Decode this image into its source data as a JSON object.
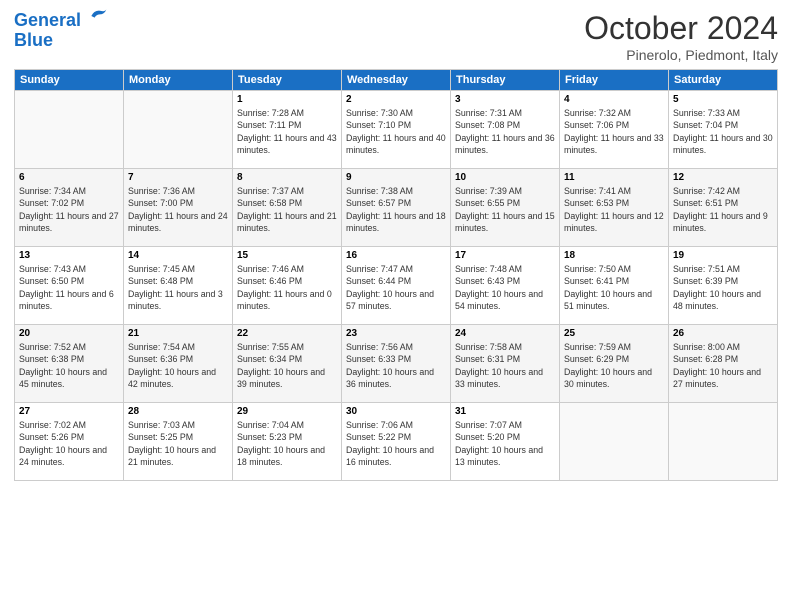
{
  "logo": {
    "line1": "General",
    "line2": "Blue"
  },
  "title": "October 2024",
  "location": "Pinerolo, Piedmont, Italy",
  "weekdays": [
    "Sunday",
    "Monday",
    "Tuesday",
    "Wednesday",
    "Thursday",
    "Friday",
    "Saturday"
  ],
  "weeks": [
    [
      {
        "day": "",
        "info": ""
      },
      {
        "day": "",
        "info": ""
      },
      {
        "day": "1",
        "info": "Sunrise: 7:28 AM\nSunset: 7:11 PM\nDaylight: 11 hours and 43 minutes."
      },
      {
        "day": "2",
        "info": "Sunrise: 7:30 AM\nSunset: 7:10 PM\nDaylight: 11 hours and 40 minutes."
      },
      {
        "day": "3",
        "info": "Sunrise: 7:31 AM\nSunset: 7:08 PM\nDaylight: 11 hours and 36 minutes."
      },
      {
        "day": "4",
        "info": "Sunrise: 7:32 AM\nSunset: 7:06 PM\nDaylight: 11 hours and 33 minutes."
      },
      {
        "day": "5",
        "info": "Sunrise: 7:33 AM\nSunset: 7:04 PM\nDaylight: 11 hours and 30 minutes."
      }
    ],
    [
      {
        "day": "6",
        "info": "Sunrise: 7:34 AM\nSunset: 7:02 PM\nDaylight: 11 hours and 27 minutes."
      },
      {
        "day": "7",
        "info": "Sunrise: 7:36 AM\nSunset: 7:00 PM\nDaylight: 11 hours and 24 minutes."
      },
      {
        "day": "8",
        "info": "Sunrise: 7:37 AM\nSunset: 6:58 PM\nDaylight: 11 hours and 21 minutes."
      },
      {
        "day": "9",
        "info": "Sunrise: 7:38 AM\nSunset: 6:57 PM\nDaylight: 11 hours and 18 minutes."
      },
      {
        "day": "10",
        "info": "Sunrise: 7:39 AM\nSunset: 6:55 PM\nDaylight: 11 hours and 15 minutes."
      },
      {
        "day": "11",
        "info": "Sunrise: 7:41 AM\nSunset: 6:53 PM\nDaylight: 11 hours and 12 minutes."
      },
      {
        "day": "12",
        "info": "Sunrise: 7:42 AM\nSunset: 6:51 PM\nDaylight: 11 hours and 9 minutes."
      }
    ],
    [
      {
        "day": "13",
        "info": "Sunrise: 7:43 AM\nSunset: 6:50 PM\nDaylight: 11 hours and 6 minutes."
      },
      {
        "day": "14",
        "info": "Sunrise: 7:45 AM\nSunset: 6:48 PM\nDaylight: 11 hours and 3 minutes."
      },
      {
        "day": "15",
        "info": "Sunrise: 7:46 AM\nSunset: 6:46 PM\nDaylight: 11 hours and 0 minutes."
      },
      {
        "day": "16",
        "info": "Sunrise: 7:47 AM\nSunset: 6:44 PM\nDaylight: 10 hours and 57 minutes."
      },
      {
        "day": "17",
        "info": "Sunrise: 7:48 AM\nSunset: 6:43 PM\nDaylight: 10 hours and 54 minutes."
      },
      {
        "day": "18",
        "info": "Sunrise: 7:50 AM\nSunset: 6:41 PM\nDaylight: 10 hours and 51 minutes."
      },
      {
        "day": "19",
        "info": "Sunrise: 7:51 AM\nSunset: 6:39 PM\nDaylight: 10 hours and 48 minutes."
      }
    ],
    [
      {
        "day": "20",
        "info": "Sunrise: 7:52 AM\nSunset: 6:38 PM\nDaylight: 10 hours and 45 minutes."
      },
      {
        "day": "21",
        "info": "Sunrise: 7:54 AM\nSunset: 6:36 PM\nDaylight: 10 hours and 42 minutes."
      },
      {
        "day": "22",
        "info": "Sunrise: 7:55 AM\nSunset: 6:34 PM\nDaylight: 10 hours and 39 minutes."
      },
      {
        "day": "23",
        "info": "Sunrise: 7:56 AM\nSunset: 6:33 PM\nDaylight: 10 hours and 36 minutes."
      },
      {
        "day": "24",
        "info": "Sunrise: 7:58 AM\nSunset: 6:31 PM\nDaylight: 10 hours and 33 minutes."
      },
      {
        "day": "25",
        "info": "Sunrise: 7:59 AM\nSunset: 6:29 PM\nDaylight: 10 hours and 30 minutes."
      },
      {
        "day": "26",
        "info": "Sunrise: 8:00 AM\nSunset: 6:28 PM\nDaylight: 10 hours and 27 minutes."
      }
    ],
    [
      {
        "day": "27",
        "info": "Sunrise: 7:02 AM\nSunset: 5:26 PM\nDaylight: 10 hours and 24 minutes."
      },
      {
        "day": "28",
        "info": "Sunrise: 7:03 AM\nSunset: 5:25 PM\nDaylight: 10 hours and 21 minutes."
      },
      {
        "day": "29",
        "info": "Sunrise: 7:04 AM\nSunset: 5:23 PM\nDaylight: 10 hours and 18 minutes."
      },
      {
        "day": "30",
        "info": "Sunrise: 7:06 AM\nSunset: 5:22 PM\nDaylight: 10 hours and 16 minutes."
      },
      {
        "day": "31",
        "info": "Sunrise: 7:07 AM\nSunset: 5:20 PM\nDaylight: 10 hours and 13 minutes."
      },
      {
        "day": "",
        "info": ""
      },
      {
        "day": "",
        "info": ""
      }
    ]
  ]
}
